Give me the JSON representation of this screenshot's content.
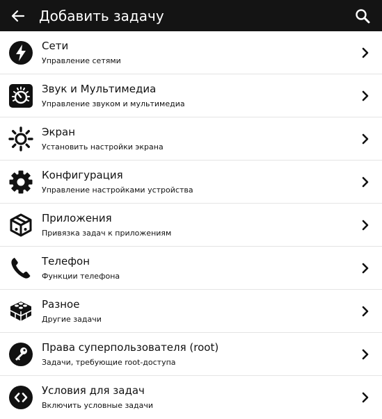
{
  "colors": {
    "appbar": "#141414",
    "divider": "#e4e4e4",
    "text": "#111111"
  },
  "header": {
    "title": "Добавить задачу",
    "back_icon": "arrow-left-icon",
    "search_icon": "search-icon"
  },
  "items": [
    {
      "title": "Сети",
      "subtitle": "Управление сетями",
      "icon": "lightning-icon"
    },
    {
      "title": "Звук и Мультимедиа",
      "subtitle": "Управление звуком и мультимедиа",
      "icon": "volume-knob-icon"
    },
    {
      "title": "Экран",
      "subtitle": "Установить настройки экрана",
      "icon": "brightness-icon"
    },
    {
      "title": "Конфигурация",
      "subtitle": "Управление настройками устройства",
      "icon": "gear-icon"
    },
    {
      "title": "Приложения",
      "subtitle": "Привязка задач к приложениям",
      "icon": "cube-icon"
    },
    {
      "title": "Телефон",
      "subtitle": "Функции телефона",
      "icon": "phone-icon"
    },
    {
      "title": "Разное",
      "subtitle": "Другие задачи",
      "icon": "bricks-icon"
    },
    {
      "title": "Права суперпользователя (root)",
      "subtitle": "Задачи, требующие root-доступа",
      "icon": "key-icon"
    },
    {
      "title": "Условия для задач",
      "subtitle": "Включить условные задачи",
      "icon": "code-icon"
    }
  ]
}
